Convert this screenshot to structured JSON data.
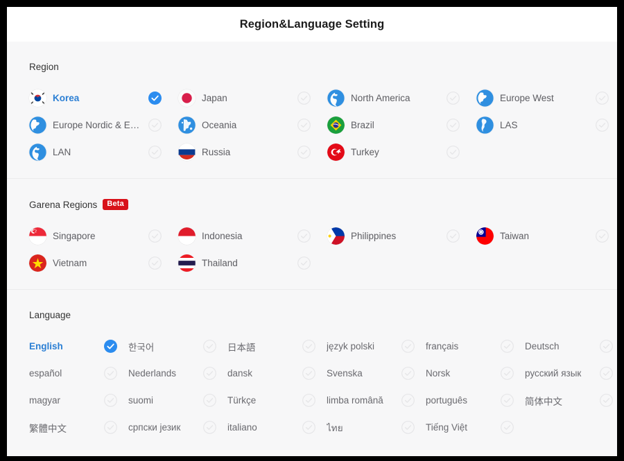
{
  "header": {
    "title": "Region&Language Setting"
  },
  "colors": {
    "accent": "#2b7fd4",
    "selected_check": "#2b8cef",
    "unselected_check": "#e3e3e5",
    "beta_badge": "#d8121a",
    "page_background": "#f7f7f8",
    "header_background": "#ffffff",
    "label_text": "#5d5d62",
    "divider": "#ebebec"
  },
  "sections": {
    "region": {
      "title": "Region",
      "items": [
        {
          "label": "Korea",
          "flag": "flag-korea",
          "selected": true
        },
        {
          "label": "Japan",
          "flag": "flag-japan",
          "selected": false
        },
        {
          "label": "North America",
          "flag": "globe-americas",
          "selected": false
        },
        {
          "label": "Europe West",
          "flag": "globe-europe",
          "selected": false
        },
        {
          "label": "Europe Nordic & E…",
          "flag": "globe-europe",
          "selected": false
        },
        {
          "label": "Oceania",
          "flag": "globe-oceania",
          "selected": false
        },
        {
          "label": "Brazil",
          "flag": "flag-brazil",
          "selected": false
        },
        {
          "label": "LAS",
          "flag": "globe-south-america",
          "selected": false
        },
        {
          "label": "LAN",
          "flag": "globe-americas",
          "selected": false
        },
        {
          "label": "Russia",
          "flag": "flag-russia",
          "selected": false
        },
        {
          "label": "Turkey",
          "flag": "flag-turkey",
          "selected": false
        }
      ]
    },
    "garena": {
      "title": "Garena Regions",
      "badge": "Beta",
      "items": [
        {
          "label": "Singapore",
          "flag": "flag-singapore",
          "selected": false
        },
        {
          "label": "Indonesia",
          "flag": "flag-indonesia",
          "selected": false
        },
        {
          "label": "Philippines",
          "flag": "flag-philippines",
          "selected": false
        },
        {
          "label": "Taiwan",
          "flag": "flag-taiwan",
          "selected": false
        },
        {
          "label": "Vietnam",
          "flag": "flag-vietnam",
          "selected": false
        },
        {
          "label": "Thailand",
          "flag": "flag-thailand",
          "selected": false
        }
      ]
    },
    "language": {
      "title": "Language",
      "items": [
        {
          "label": "English",
          "selected": true
        },
        {
          "label": "한국어",
          "selected": false
        },
        {
          "label": "日本語",
          "selected": false
        },
        {
          "label": "język polski",
          "selected": false
        },
        {
          "label": "français",
          "selected": false
        },
        {
          "label": "Deutsch",
          "selected": false
        },
        {
          "label": "español",
          "selected": false
        },
        {
          "label": "Nederlands",
          "selected": false
        },
        {
          "label": "dansk",
          "selected": false
        },
        {
          "label": "Svenska",
          "selected": false
        },
        {
          "label": "Norsk",
          "selected": false
        },
        {
          "label": "русский язык",
          "selected": false
        },
        {
          "label": "magyar",
          "selected": false
        },
        {
          "label": "suomi",
          "selected": false
        },
        {
          "label": "Türkçe",
          "selected": false
        },
        {
          "label": "limba română",
          "selected": false
        },
        {
          "label": "português",
          "selected": false
        },
        {
          "label": "简体中文",
          "selected": false
        },
        {
          "label": "繁體中文",
          "selected": false
        },
        {
          "label": "српски језик",
          "selected": false
        },
        {
          "label": "italiano",
          "selected": false
        },
        {
          "label": "ไทย",
          "selected": false
        },
        {
          "label": "Tiếng Việt",
          "selected": false
        }
      ]
    }
  },
  "icons": {
    "selected_check": "check-circle-filled-icon",
    "unselected_check": "check-circle-outline-icon"
  }
}
